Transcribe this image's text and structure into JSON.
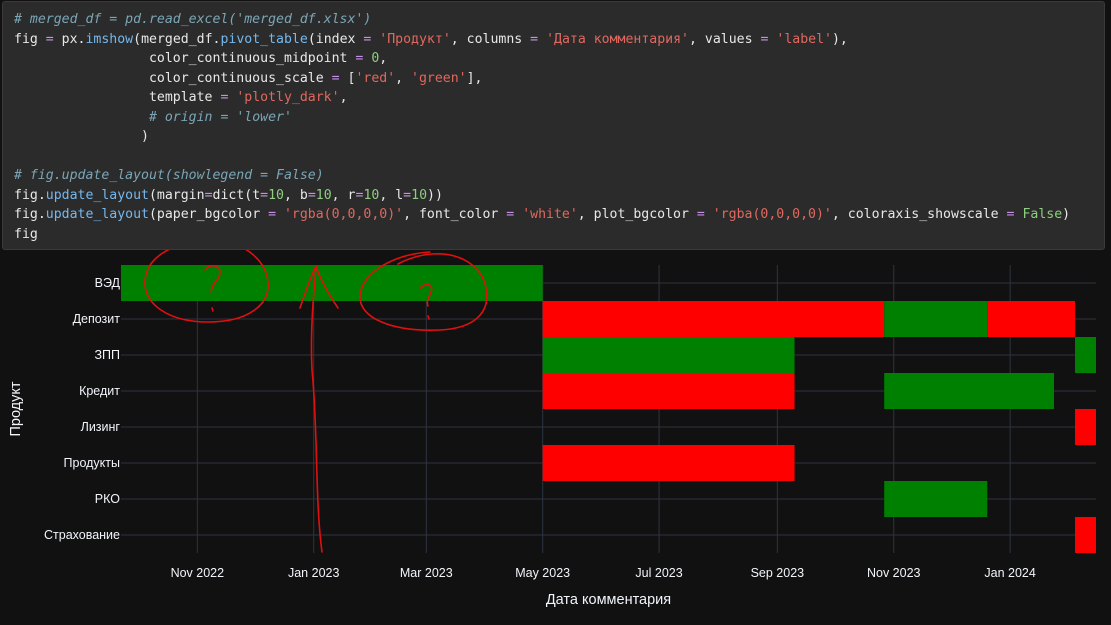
{
  "code_lines": [
    [
      [
        "t-comment",
        "# merged_df = pd.read_excel('merged_df.xlsx')"
      ]
    ],
    [
      [
        "t-plain",
        "fig "
      ],
      [
        "t-op",
        "="
      ],
      [
        "t-plain",
        " px."
      ],
      [
        "t-attr",
        "imshow"
      ],
      [
        "t-plain",
        "(merged_df."
      ],
      [
        "t-attr",
        "pivot_table"
      ],
      [
        "t-plain",
        "(index "
      ],
      [
        "t-op",
        "="
      ],
      [
        "t-plain",
        " "
      ],
      [
        "t-str",
        "'Продукт'"
      ],
      [
        "t-plain",
        ", columns "
      ],
      [
        "t-op",
        "="
      ],
      [
        "t-plain",
        " "
      ],
      [
        "t-str",
        "'Дата комментария'"
      ],
      [
        "t-plain",
        ", values "
      ],
      [
        "t-op",
        "="
      ],
      [
        "t-plain",
        " "
      ],
      [
        "t-str",
        "'label'"
      ],
      [
        "t-plain",
        "),"
      ]
    ],
    [
      [
        "t-plain",
        "                 color_continuous_midpoint "
      ],
      [
        "t-op",
        "="
      ],
      [
        "t-plain",
        " "
      ],
      [
        "t-num",
        "0"
      ],
      [
        "t-plain",
        ","
      ]
    ],
    [
      [
        "t-plain",
        "                 color_continuous_scale "
      ],
      [
        "t-op",
        "="
      ],
      [
        "t-plain",
        " ["
      ],
      [
        "t-str",
        "'red'"
      ],
      [
        "t-plain",
        ", "
      ],
      [
        "t-str",
        "'green'"
      ],
      [
        "t-plain",
        "],"
      ]
    ],
    [
      [
        "t-plain",
        "                 template "
      ],
      [
        "t-op",
        "="
      ],
      [
        "t-plain",
        " "
      ],
      [
        "t-str",
        "'plotly_dark'"
      ],
      [
        "t-plain",
        ","
      ]
    ],
    [
      [
        "t-plain",
        "                 "
      ],
      [
        "t-comment",
        "# origin = 'lower'"
      ]
    ],
    [
      [
        "t-plain",
        "                )"
      ]
    ],
    [
      [
        "t-plain",
        ""
      ]
    ],
    [
      [
        "t-comment",
        "# fig.update_layout(showlegend = False)"
      ]
    ],
    [
      [
        "t-plain",
        "fig."
      ],
      [
        "t-attr",
        "update_layout"
      ],
      [
        "t-plain",
        "(margin"
      ],
      [
        "t-op",
        "="
      ],
      [
        "t-plain",
        "dict(t"
      ],
      [
        "t-op",
        "="
      ],
      [
        "t-num",
        "10"
      ],
      [
        "t-plain",
        ", b"
      ],
      [
        "t-op",
        "="
      ],
      [
        "t-num",
        "10"
      ],
      [
        "t-plain",
        ", r"
      ],
      [
        "t-op",
        "="
      ],
      [
        "t-num",
        "10"
      ],
      [
        "t-plain",
        ", l"
      ],
      [
        "t-op",
        "="
      ],
      [
        "t-num",
        "10"
      ],
      [
        "t-plain",
        "))"
      ]
    ],
    [
      [
        "t-plain",
        "fig."
      ],
      [
        "t-attr",
        "update_layout"
      ],
      [
        "t-plain",
        "(paper_bgcolor "
      ],
      [
        "t-op",
        "="
      ],
      [
        "t-plain",
        " "
      ],
      [
        "t-str",
        "'rgba(0,0,0,0)'"
      ],
      [
        "t-plain",
        ", font_color "
      ],
      [
        "t-op",
        "="
      ],
      [
        "t-plain",
        " "
      ],
      [
        "t-str",
        "'white'"
      ],
      [
        "t-plain",
        ", plot_bgcolor "
      ],
      [
        "t-op",
        "="
      ],
      [
        "t-plain",
        " "
      ],
      [
        "t-str",
        "'rgba(0,0,0,0)'"
      ],
      [
        "t-plain",
        ", coloraxis_showscale "
      ],
      [
        "t-op",
        "="
      ],
      [
        "t-plain",
        " "
      ],
      [
        "t-bool",
        "False"
      ],
      [
        "t-plain",
        ")"
      ]
    ],
    [
      [
        "t-plain",
        "fig"
      ]
    ]
  ],
  "chart_data": {
    "type": "heatmap",
    "xlabel": "Дата комментария",
    "ylabel": "Продукт",
    "categories": [
      "ВЭД",
      "Депозит",
      "ЗПП",
      "Кредит",
      "Лизинг",
      "Продукты",
      "РКО",
      "Страхование"
    ],
    "x_ticks": [
      "Nov 2022",
      "Jan 2023",
      "Mar 2023",
      "May 2023",
      "Jul 2023",
      "Sep 2023",
      "Nov 2023",
      "Jan 2024"
    ],
    "xlim": [
      "2022-09-22",
      "2024-02-15"
    ],
    "colors": {
      "positive": "#008000",
      "negative": "#ff0000"
    },
    "cells": [
      {
        "product": "ВЭД",
        "start": "2022-09-22",
        "end": "2023-05-01",
        "label": 1
      },
      {
        "product": "Депозит",
        "start": "2023-05-01",
        "end": "2023-10-27",
        "label": -1
      },
      {
        "product": "Депозит",
        "start": "2023-10-27",
        "end": "2023-12-20",
        "label": 1
      },
      {
        "product": "Депозит",
        "start": "2023-12-20",
        "end": "2024-02-04",
        "label": -1
      },
      {
        "product": "ЗПП",
        "start": "2023-05-01",
        "end": "2023-09-10",
        "label": 1
      },
      {
        "product": "ЗПП",
        "start": "2024-02-04",
        "end": "2024-02-15",
        "label": 1
      },
      {
        "product": "Кредит",
        "start": "2023-05-01",
        "end": "2023-09-10",
        "label": -1
      },
      {
        "product": "Кредит",
        "start": "2023-10-27",
        "end": "2024-01-24",
        "label": 1
      },
      {
        "product": "Лизинг",
        "start": "2024-02-04",
        "end": "2024-02-15",
        "label": -1
      },
      {
        "product": "Продукты",
        "start": "2023-05-01",
        "end": "2023-09-10",
        "label": -1
      },
      {
        "product": "РКО",
        "start": "2023-10-27",
        "end": "2023-12-20",
        "label": 1
      },
      {
        "product": "Страхование",
        "start": "2024-02-04",
        "end": "2024-02-15",
        "label": -1
      }
    ],
    "grid": true
  },
  "annotations": {
    "color": "#e01010",
    "marks": [
      "?",
      "?",
      "↑"
    ]
  }
}
